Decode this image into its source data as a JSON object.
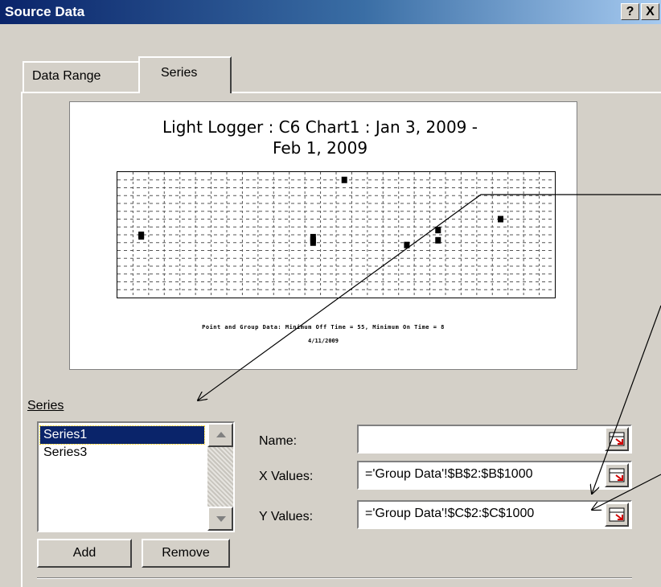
{
  "window": {
    "title": "Source Data",
    "help_label": "?",
    "close_label": "X"
  },
  "tabs": [
    {
      "label": "Data Range",
      "active": false
    },
    {
      "label": "Series",
      "active": true
    }
  ],
  "chart_data": {
    "type": "scatter",
    "title_line1": "Light Logger : C6 Chart1 : Jan 3, 2009 -",
    "title_line2": "Feb 1, 2009",
    "xlabel_line1": "Point and Group Data:  Minimum Off Time = 55, Minimum On Time = 8",
    "xlabel_line2": "4/11/2009",
    "ylim": [
      0,
      1600
    ],
    "grid": true,
    "points": [
      {
        "x": 1,
        "y": 800
      },
      {
        "x": 1,
        "y": 780
      },
      {
        "x": 12,
        "y": 770
      },
      {
        "x": 12,
        "y": 730
      },
      {
        "x": 12,
        "y": 700
      },
      {
        "x": 14,
        "y": 1500
      },
      {
        "x": 18,
        "y": 670
      },
      {
        "x": 20,
        "y": 860
      },
      {
        "x": 20,
        "y": 730
      },
      {
        "x": 24,
        "y": 1000
      }
    ],
    "colors": {
      "marker": "#000000",
      "axis_ticks": "#e8dc6a"
    }
  },
  "series_panel": {
    "label": "Series",
    "items": [
      "Series1",
      "Series3"
    ],
    "selected": "Series1"
  },
  "fields": {
    "name_label": "Name:",
    "name_value": "",
    "x_label": "X Values:",
    "x_value": "='Group Data'!$B$2:$B$1000",
    "y_label": "Y Values:",
    "y_value": "='Group Data'!$C$2:$C$1000"
  },
  "buttons": {
    "add": "Add",
    "remove": "Remove"
  }
}
